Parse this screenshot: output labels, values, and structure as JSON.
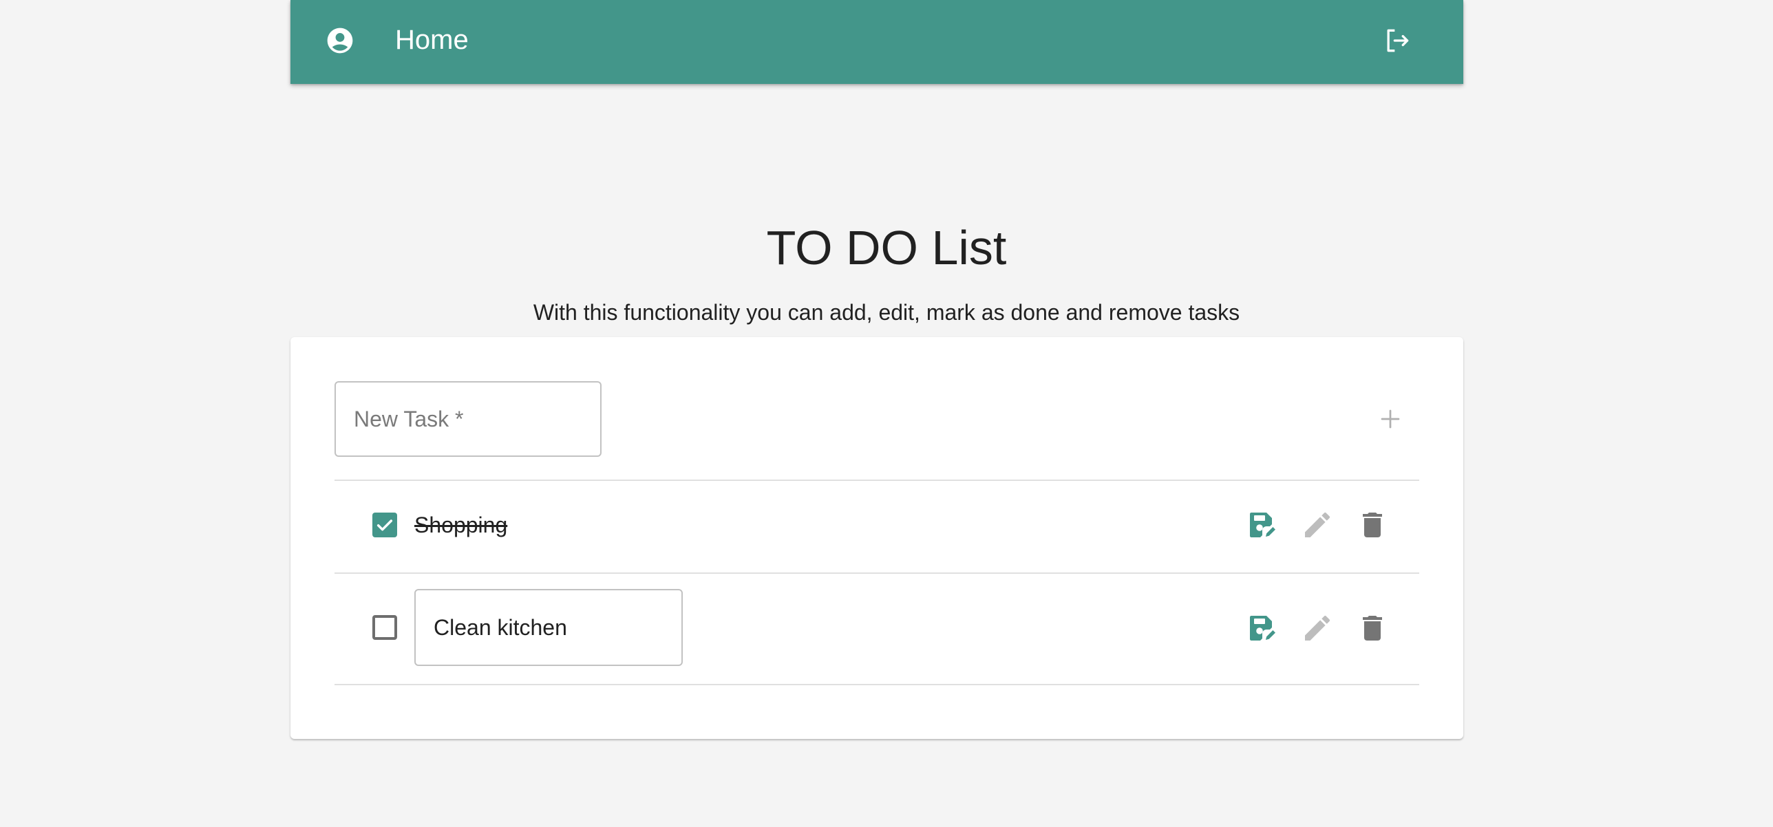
{
  "appbar": {
    "title": "Home",
    "left_icon": "account-circle-icon",
    "right_icon": "logout-icon",
    "background": "#43968a"
  },
  "page": {
    "title": "TO DO List",
    "subtitle": "With this functionality you can add, edit, mark as done and remove tasks"
  },
  "new_task": {
    "placeholder": "New Task *",
    "value": "",
    "add_icon": "plus-icon"
  },
  "tasks": [
    {
      "label": "Shopping",
      "done": true,
      "editing": false,
      "icons": [
        "save-edit-icon",
        "pencil-icon",
        "trash-icon"
      ]
    },
    {
      "label": "Clean kitchen",
      "done": false,
      "editing": true,
      "icons": [
        "save-edit-icon",
        "pencil-icon",
        "trash-icon"
      ]
    }
  ],
  "colors": {
    "accent": "#43968a",
    "disabled_icon": "#bdbdbd",
    "delete_icon": "#757575",
    "background": "#f4f4f4"
  }
}
